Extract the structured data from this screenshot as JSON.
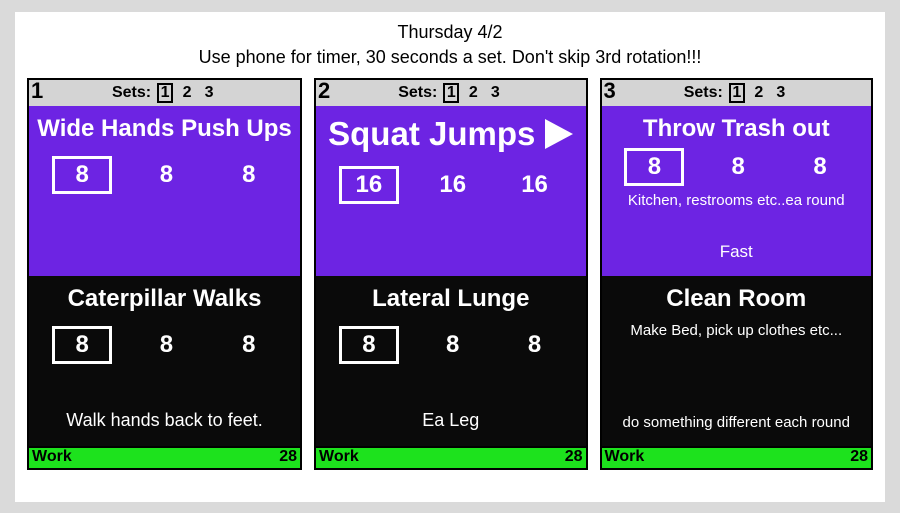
{
  "header": {
    "title": "Thursday 4/2",
    "subtitle": "Use phone for timer, 30 seconds a set. Don't skip 3rd rotation!!!"
  },
  "sets_label": "Sets:",
  "cards": [
    {
      "number": "1",
      "sets": [
        "1",
        "2",
        "3"
      ],
      "active_set": 0,
      "top": {
        "title": "Wide Hands Push Ups",
        "has_play": false,
        "reps": [
          "8",
          "8",
          "8"
        ],
        "note": "",
        "note2": ""
      },
      "bottom": {
        "title": "Caterpillar Walks",
        "reps": [
          "8",
          "8",
          "8"
        ],
        "note": "Walk hands back to feet.",
        "note2": ""
      },
      "timer": {
        "label": "Work",
        "value": "28"
      }
    },
    {
      "number": "2",
      "sets": [
        "1",
        "2",
        "3"
      ],
      "active_set": 0,
      "top": {
        "title": "Squat Jumps",
        "has_play": true,
        "reps": [
          "16",
          "16",
          "16"
        ],
        "note": "",
        "note2": ""
      },
      "bottom": {
        "title": "Lateral Lunge",
        "reps": [
          "8",
          "8",
          "8"
        ],
        "note": "Ea Leg",
        "note2": ""
      },
      "timer": {
        "label": "Work",
        "value": "28"
      }
    },
    {
      "number": "3",
      "sets": [
        "1",
        "2",
        "3"
      ],
      "active_set": 0,
      "top": {
        "title": "Throw Trash out",
        "has_play": false,
        "reps": [
          "8",
          "8",
          "8"
        ],
        "note": "Kitchen, restrooms etc..ea round",
        "note2": "Fast"
      },
      "bottom": {
        "title": "Clean Room",
        "reps": null,
        "note": "Make Bed, pick up clothes etc...",
        "note2": "do something different each round"
      },
      "timer": {
        "label": "Work",
        "value": "28"
      }
    }
  ]
}
